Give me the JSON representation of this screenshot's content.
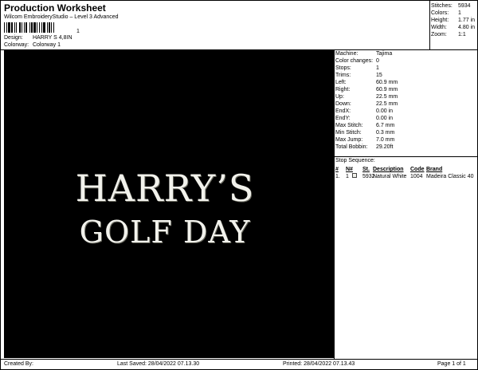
{
  "header": {
    "title": "Production Worksheet",
    "software": "Wilcom EmbroideryStudio – Level 3 Advanced",
    "barcode_number": "1"
  },
  "design": {
    "design_label": "Design:",
    "design_value": "HARRY S 4,8IN",
    "colorway_label": "Colorway:",
    "colorway_value": "Colorway 1"
  },
  "stats": [
    {
      "label": "Stitches:",
      "value": "5934"
    },
    {
      "label": "Colors:",
      "value": "1"
    },
    {
      "label": "Height:",
      "value": "1.77 in"
    },
    {
      "label": "Width:",
      "value": "4.80 in"
    },
    {
      "label": "Zoom:",
      "value": "1:1"
    }
  ],
  "artwork": {
    "line1": "HARRY’S",
    "line2": "GOLF DAY",
    "thread_color": "#f2f2ec",
    "background_color": "#000000"
  },
  "properties": [
    {
      "label": "Machine:",
      "value": "Tajima"
    },
    {
      "label": "Color changes:",
      "value": "0"
    },
    {
      "label": "Stops:",
      "value": "1"
    },
    {
      "label": "Trims:",
      "value": "15"
    },
    {
      "label": "Left:",
      "value": "60.9 mm"
    },
    {
      "label": "Right:",
      "value": "60.9 mm"
    },
    {
      "label": "Up:",
      "value": "22.5 mm"
    },
    {
      "label": "Down:",
      "value": "22.5 mm"
    },
    {
      "label": "EndX:",
      "value": "0.00 in"
    },
    {
      "label": "EndY:",
      "value": "0.00 in"
    },
    {
      "label": "Max Stitch:",
      "value": "6.7 mm"
    },
    {
      "label": "Min Stitch:",
      "value": "0.3 mm"
    },
    {
      "label": "Max Jump:",
      "value": "7.0 mm"
    },
    {
      "label": "Total Bobbin:",
      "value": "29.20ft"
    }
  ],
  "stop_sequence": {
    "title": "Stop Sequence:",
    "headers": {
      "num": "#",
      "n": "N#",
      "st": "St.",
      "description": "Description",
      "code": "Code",
      "brand": "Brand"
    },
    "rows": [
      {
        "num": "1.",
        "n": "1",
        "st": "5932",
        "description": "Natural White",
        "code": "1004",
        "brand": "Madeira Classic 40"
      }
    ]
  },
  "footer": {
    "created_by": "Created By:",
    "last_saved": "Last Saved: 28/04/2022 07.13.30",
    "printed": "Printed: 28/04/2022 07.13.43",
    "page": "Page 1 of 1"
  }
}
